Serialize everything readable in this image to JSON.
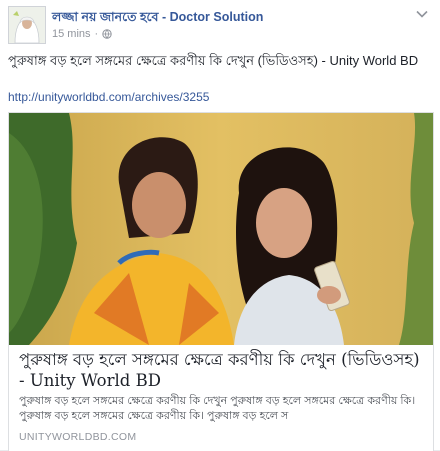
{
  "post": {
    "author": "লজ্জা নয় জানতে হবে - Doctor Solution",
    "time": "15 mins",
    "separator": "·",
    "privacy_icon": "globe-icon",
    "menu_icon": "chevron-down-icon",
    "text": "পুরুষাঙ্গ বড় হলে সঙ্গমের ক্ষেত্রে করণীয় কি দেখুন (ভিডিওসহ) - Unity World BD",
    "link": "http://unityworldbd.com/archives/3255"
  },
  "card": {
    "title": "পুরুষাঙ্গ বড় হলে সঙ্গমের ক্ষেত্রে করণীয় কি দেখুন (ভিডিওসহ) - Unity World BD",
    "description": "পুরুষাঙ্গ বড় হলে সঙ্গমের ক্ষেত্রে করণীয় কি দেখুন পুরুষাঙ্গ বড় হলে সঙ্গমের ক্ষেত্রে করণীয় কি। পুরুষাঙ্গ বড় হলে সঙ্গমের ক্ষেত্রে করণীয় কি। পুরুষাঙ্গ বড় হলে স",
    "domain": "UNITYWORLDBD.COM"
  },
  "colors": {
    "link": "#365899",
    "text": "#1d2129",
    "meta": "#90949c"
  }
}
